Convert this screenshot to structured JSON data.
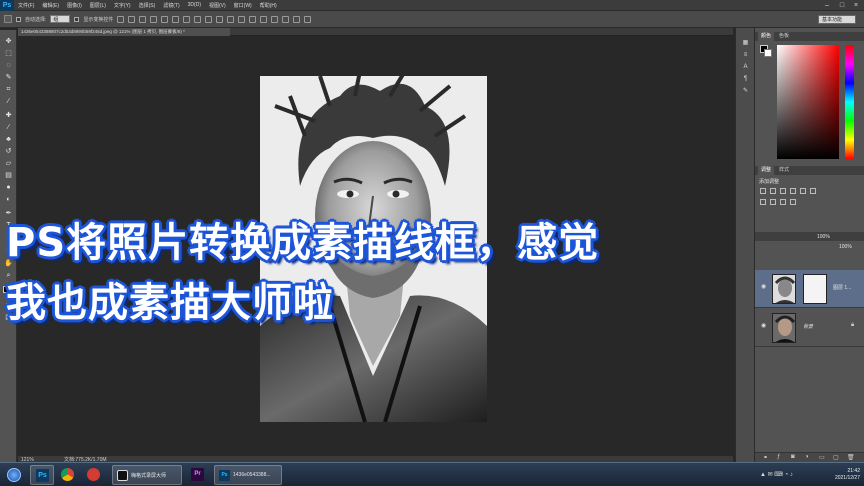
{
  "app": {
    "logo_text": "Ps",
    "workspace": "基本功能"
  },
  "menubar": {
    "items": [
      "文件(F)",
      "编辑(E)",
      "图像(I)",
      "图层(L)",
      "文字(Y)",
      "选择(S)",
      "滤镜(T)",
      "3D(D)",
      "视图(V)",
      "窗口(W)",
      "帮助(H)"
    ],
    "window_controls": [
      "–",
      "□",
      "×"
    ]
  },
  "options": {
    "auto_select_label": "自动选择:",
    "auto_select_value": "组",
    "show_transform_label": "显示变换控件"
  },
  "document": {
    "tab_title": "1436e0543388807c2d53d8990b59f245d.jpeg @ 121% (图层 1 拷贝, 图层蒙板/8) *",
    "zoom": "121%",
    "doc_size": "文档:775.2K/1.70M"
  },
  "panels": {
    "color_tabs": [
      "颜色",
      "色板"
    ],
    "adjust_tabs": [
      "调整",
      "样式"
    ],
    "adjust_label": "添加调整",
    "opacity_value": "100%",
    "fill_value": "100%",
    "layers": [
      {
        "name": "图层 1...",
        "selected": true
      },
      {
        "name": "背景",
        "selected": false
      }
    ]
  },
  "taskbar": {
    "apps": [
      "Ps",
      "chrome",
      "netease",
      "record",
      "premiere",
      "ps-doc"
    ],
    "record_label": "嗨格式录屏大师",
    "ps_doc_label": "1436e0543388...",
    "time": "21:42",
    "date": "2021/12/27"
  },
  "overlay": {
    "line1": "PS将照片转换成素描线框，感觉",
    "line2": "我也成素描大师啦"
  },
  "colors": {
    "overlay_stroke": "#1e56d8",
    "selected_layer": "#5c6e8a",
    "ps_blue": "#33b5ff"
  }
}
